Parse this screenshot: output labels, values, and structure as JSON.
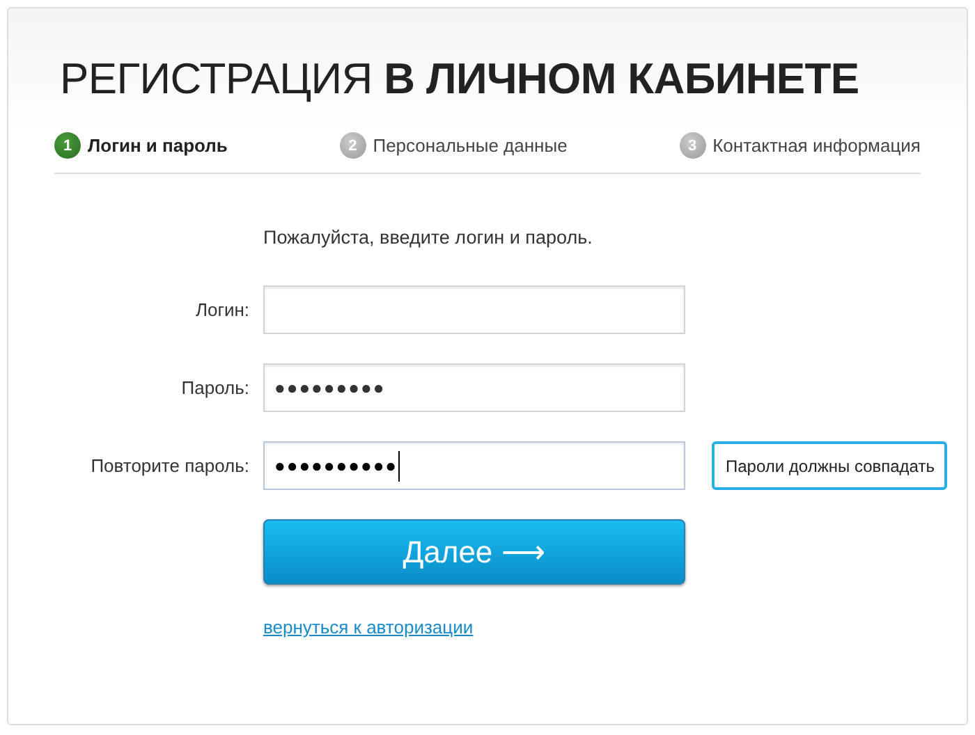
{
  "title": "РЕГИСТРАЦИЯ **В ЛИЧНОМ КАБИНЕТЕ**",
  "steps": [
    {
      "number": "1",
      "label": "Логин и пароль",
      "selected": true
    },
    {
      "number": "2",
      "label": "Персональные данные",
      "selected": false
    },
    {
      "number": "3",
      "label": "Контактная информация",
      "selected": false
    }
  ],
  "intro": "Пожалуйста, введите логин и пароль.",
  "fields": [
    {
      "label": "Логин:",
      "focused": false
    },
    {
      "label": "Пароль:",
      "value": "●●●●●●●●●",
      "focused": false
    },
    {
      "label": "Повторите пароль:",
      "value": "●●●●●●●●●●",
      "focused": true,
      "error": "Пароли должны совпадать"
    }
  ],
  "submit": "Далее ⟶",
  "back_link": "вернуться к авторизации"
}
